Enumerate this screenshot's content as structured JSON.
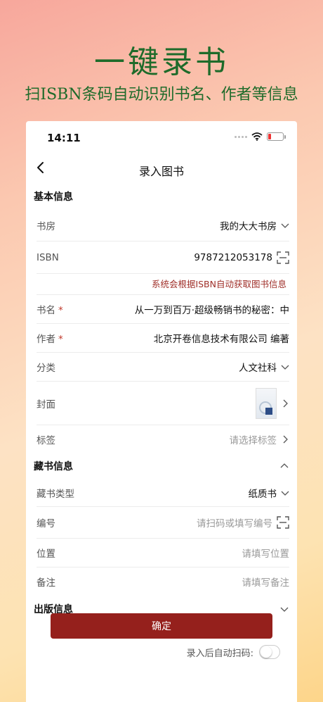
{
  "promo": {
    "title": "一键录书",
    "subtitle": "扫ISBN条码自动识别书名、作者等信息"
  },
  "status_bar": {
    "time": "14:11"
  },
  "nav": {
    "title": "录入图书"
  },
  "basic_section": {
    "title": "基本信息",
    "library": {
      "label": "书房",
      "value": "我的大大书房"
    },
    "isbn": {
      "label": "ISBN",
      "value": "9787212053178"
    },
    "isbn_hint": "系统会根据ISBN自动获取图书信息",
    "book_name": {
      "label": "书名",
      "required_mark": "*",
      "value": "从一万到百万·超级畅销书的秘密：中"
    },
    "author": {
      "label": "作者",
      "required_mark": "*",
      "value": "北京开卷信息技术有限公司 编著"
    },
    "category": {
      "label": "分类",
      "value": "人文社科"
    },
    "cover": {
      "label": "封面"
    },
    "tags": {
      "label": "标签",
      "placeholder": "请选择标签"
    }
  },
  "collection_section": {
    "title": "藏书信息",
    "type": {
      "label": "藏书类型",
      "value": "纸质书"
    },
    "number": {
      "label": "编号",
      "placeholder": "请扫码或填写编号"
    },
    "location": {
      "label": "位置",
      "placeholder": "请填写位置"
    },
    "note": {
      "label": "备注",
      "placeholder": "请填写备注"
    }
  },
  "publish_section": {
    "title": "出版信息"
  },
  "actions": {
    "confirm": "确定",
    "auto_scan_label": "录入后自动扫码:",
    "auto_scan_on": false
  },
  "colors": {
    "accent": "#95201c",
    "promo_text": "#1e6b2a",
    "hint": "#a0302a"
  }
}
